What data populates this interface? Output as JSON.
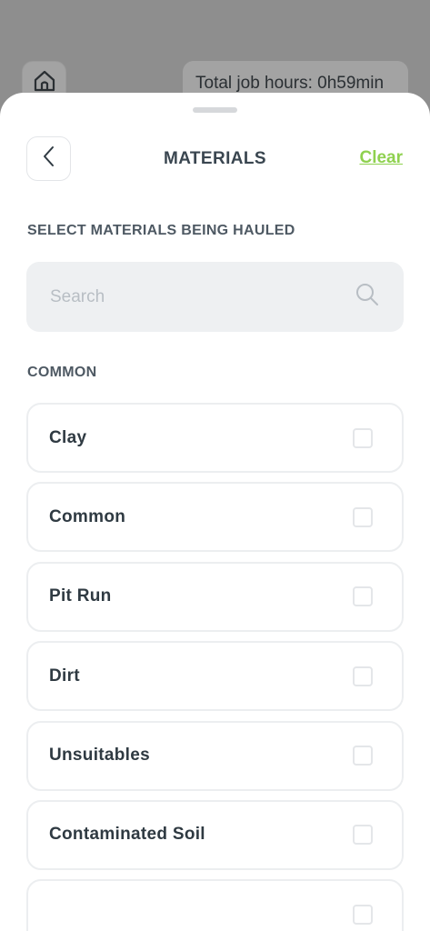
{
  "background": {
    "job_hours_text": "Total job hours: 0h59min"
  },
  "sheet": {
    "title": "MATERIALS",
    "clear_label": "Clear",
    "select_heading": "SELECT MATERIALS BEING HAULED",
    "search": {
      "placeholder": "Search",
      "value": ""
    },
    "group_heading": "COMMON",
    "items": [
      {
        "label": "Clay",
        "checked": false
      },
      {
        "label": "Common",
        "checked": false
      },
      {
        "label": "Pit Run",
        "checked": false
      },
      {
        "label": "Dirt",
        "checked": false
      },
      {
        "label": "Unsuitables",
        "checked": false
      },
      {
        "label": "Contaminated Soil",
        "checked": false
      },
      {
        "label": "",
        "checked": false
      }
    ]
  },
  "colors": {
    "accent": "#8fd14f",
    "text_dark": "#2f3a42",
    "overlay": "#8e8e8e"
  }
}
